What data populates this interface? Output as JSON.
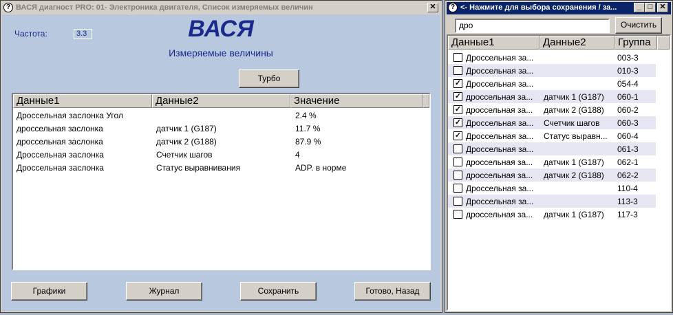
{
  "main_window": {
    "title": "ВАСЯ диагност PRO: 01- Электроника двигателя,  Список измеряемых величин",
    "freq_label": "Частота:",
    "freq_value": "3.3",
    "logo": "ВАСЯ",
    "subtitle": "Измеряемые величины",
    "turbo": "Турбо",
    "columns": [
      "Данные1",
      "Данные2",
      "Значение"
    ],
    "rows": [
      [
        "Дроссельная заслонка Угол",
        "",
        "2.4 %"
      ],
      [
        "дроссельная заслонка",
        "датчик 1 (G187)",
        "11.7 %"
      ],
      [
        "дроссельная заслонка",
        "датчик 2 (G188)",
        "87.9 %"
      ],
      [
        "Дроссельная заслонка",
        "Счетчик шагов",
        "4"
      ],
      [
        "Дроссельная заслонка",
        "Статус выравнивания",
        "ADP. в норме"
      ]
    ],
    "buttons": {
      "graphs": "Графики",
      "journal": "Журнал",
      "save": "Сохранить",
      "done": "Готово, Назад"
    },
    "close_glyph": "✕"
  },
  "side_window": {
    "title": "<- Нажмите для выбора сохранения / за...",
    "search_value": "дро",
    "clear": "Очистить",
    "columns": [
      "Данные1",
      "Данные2",
      "Группа"
    ],
    "rows": [
      {
        "checked": false,
        "d1": "Дроссельная за...",
        "d2": "",
        "group": "003-3"
      },
      {
        "checked": false,
        "d1": "Дроссельная за...",
        "d2": "",
        "group": "010-3"
      },
      {
        "checked": true,
        "d1": "Дроссельная за...",
        "d2": "",
        "group": "054-4"
      },
      {
        "checked": true,
        "d1": "дроссельная за...",
        "d2": "датчик 1 (G187)",
        "group": "060-1"
      },
      {
        "checked": true,
        "d1": "дроссельная за...",
        "d2": "датчик 2 (G188)",
        "group": "060-2"
      },
      {
        "checked": true,
        "d1": "Дроссельная за...",
        "d2": "Счетчик шагов",
        "group": "060-3"
      },
      {
        "checked": true,
        "d1": "Дроссельная за...",
        "d2": "Статус выравн...",
        "group": "060-4"
      },
      {
        "checked": false,
        "d1": "Дроссельная за...",
        "d2": "",
        "group": "061-3"
      },
      {
        "checked": false,
        "d1": "дроссельная за...",
        "d2": "датчик 1 (G187)",
        "group": "062-1"
      },
      {
        "checked": false,
        "d1": "дроссельная за...",
        "d2": "датчик 2 (G188)",
        "group": "062-2"
      },
      {
        "checked": false,
        "d1": "Дроссельная за...",
        "d2": "",
        "group": "110-4"
      },
      {
        "checked": false,
        "d1": "Дроссельная за...",
        "d2": "",
        "group": "113-3"
      },
      {
        "checked": false,
        "d1": "дроссельная за...",
        "d2": "датчик 1 (G187)",
        "group": "117-3"
      }
    ],
    "check_glyph": "✓",
    "minimize_glyph": "_",
    "maximize_glyph": "□",
    "close_glyph": "✕"
  },
  "colors": {
    "client_bg": "#b8c8de",
    "logo_color": "#1a2a8c",
    "active_title": "#0a246a",
    "row_alt": "#e6e6f2"
  }
}
